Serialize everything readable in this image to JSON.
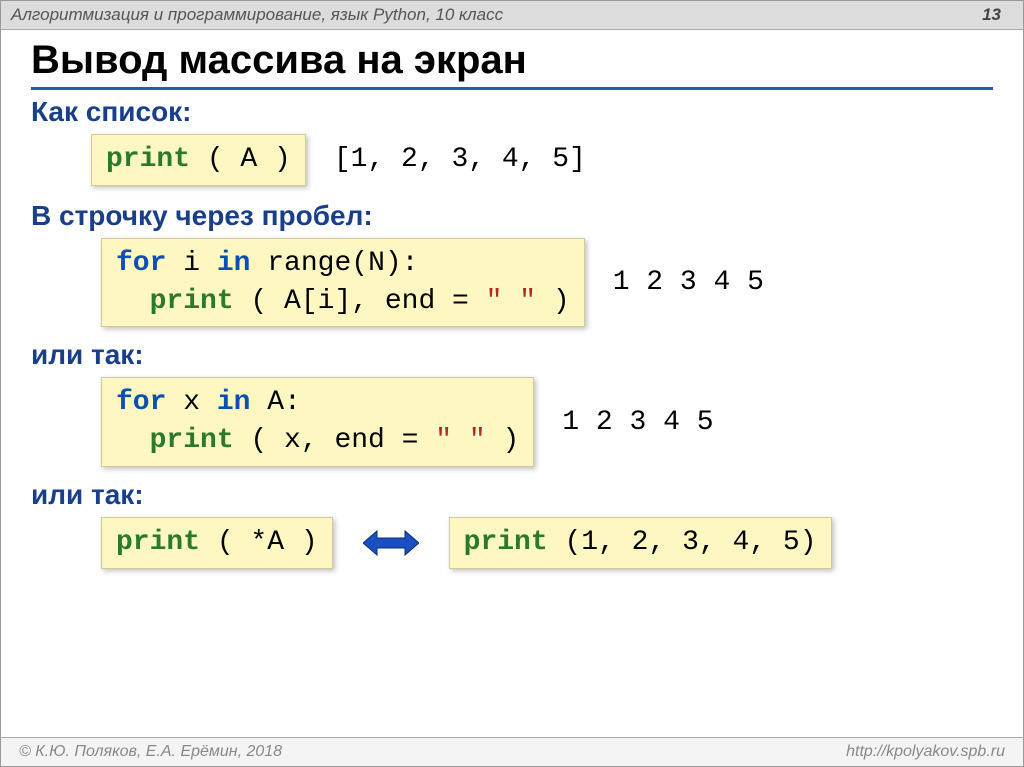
{
  "header": {
    "title": "Алгоритмизация и программирование, язык Python, 10 класс",
    "page": "13"
  },
  "title": "Вывод массива на экран",
  "s1": {
    "label": "Как список:",
    "output": "[1, 2, 3, 4, 5]"
  },
  "code1": {
    "fn": "print",
    "body": " ( A )"
  },
  "s2": {
    "label": "В строчку через пробел:"
  },
  "code2": {
    "l1a": "for",
    "l1b": " i ",
    "l1c": "in",
    "l1d": " range(N):",
    "l2fn": "print",
    "l2a": " ( A[i], end = ",
    "l2str": "\" \"",
    "l2b": " )"
  },
  "out2": "1 2 3 4 5",
  "s3": {
    "label": "или так:"
  },
  "code3": {
    "l1a": "for",
    "l1b": " x ",
    "l1c": "in",
    "l1d": " A:",
    "l2fn": "print",
    "l2a": " ( x, end = ",
    "l2str": "\" \"",
    "l2b": " )"
  },
  "out3": "1 2 3 4 5",
  "s4": {
    "label": "или так:"
  },
  "code4": {
    "fn": "print",
    "body": " ( *A )"
  },
  "code5": {
    "fn": "print",
    "body": " (1, 2, 3, 4, 5)"
  },
  "footer": {
    "left": "© К.Ю. Поляков, Е.А. Ерёмин, 2018",
    "right": "http://kpolyakov.spb.ru"
  }
}
